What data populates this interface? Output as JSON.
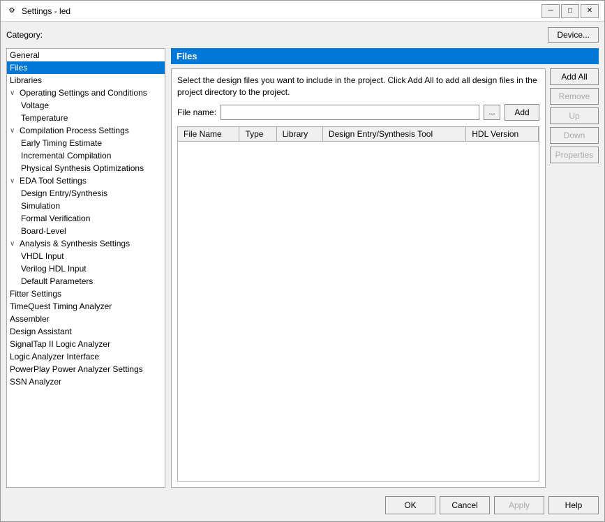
{
  "window": {
    "title": "Settings - led",
    "icon": "⚙"
  },
  "titlebar": {
    "minimize_label": "─",
    "maximize_label": "□",
    "close_label": "✕"
  },
  "header": {
    "category_label": "Category:",
    "device_button": "Device..."
  },
  "sidebar": {
    "items": [
      {
        "id": "general",
        "label": "General",
        "level": "level0",
        "selected": false,
        "toggle": ""
      },
      {
        "id": "files",
        "label": "Files",
        "level": "level0",
        "selected": true,
        "toggle": ""
      },
      {
        "id": "libraries",
        "label": "Libraries",
        "level": "level0",
        "selected": false,
        "toggle": ""
      },
      {
        "id": "operating-settings",
        "label": "Operating Settings and Conditions",
        "level": "level0",
        "selected": false,
        "toggle": "∨"
      },
      {
        "id": "voltage",
        "label": "Voltage",
        "level": "level1",
        "selected": false,
        "toggle": ""
      },
      {
        "id": "temperature",
        "label": "Temperature",
        "level": "level1",
        "selected": false,
        "toggle": ""
      },
      {
        "id": "compilation-process",
        "label": "Compilation Process Settings",
        "level": "level0",
        "selected": false,
        "toggle": "∨"
      },
      {
        "id": "early-timing",
        "label": "Early Timing Estimate",
        "level": "level1",
        "selected": false,
        "toggle": ""
      },
      {
        "id": "incremental",
        "label": "Incremental Compilation",
        "level": "level1",
        "selected": false,
        "toggle": ""
      },
      {
        "id": "physical-synthesis",
        "label": "Physical Synthesis Optimizations",
        "level": "level1",
        "selected": false,
        "toggle": ""
      },
      {
        "id": "eda-tool",
        "label": "EDA Tool Settings",
        "level": "level0",
        "selected": false,
        "toggle": "∨"
      },
      {
        "id": "design-entry",
        "label": "Design Entry/Synthesis",
        "level": "level1",
        "selected": false,
        "toggle": ""
      },
      {
        "id": "simulation",
        "label": "Simulation",
        "level": "level1",
        "selected": false,
        "toggle": ""
      },
      {
        "id": "formal-verification",
        "label": "Formal Verification",
        "level": "level1",
        "selected": false,
        "toggle": ""
      },
      {
        "id": "board-level",
        "label": "Board-Level",
        "level": "level1",
        "selected": false,
        "toggle": ""
      },
      {
        "id": "analysis-synthesis",
        "label": "Analysis & Synthesis Settings",
        "level": "level0",
        "selected": false,
        "toggle": "∨"
      },
      {
        "id": "vhdl-input",
        "label": "VHDL Input",
        "level": "level1",
        "selected": false,
        "toggle": ""
      },
      {
        "id": "verilog-hdl",
        "label": "Verilog HDL Input",
        "level": "level1",
        "selected": false,
        "toggle": ""
      },
      {
        "id": "default-params",
        "label": "Default Parameters",
        "level": "level1",
        "selected": false,
        "toggle": ""
      },
      {
        "id": "fitter",
        "label": "Fitter Settings",
        "level": "level0",
        "selected": false,
        "toggle": ""
      },
      {
        "id": "timequest",
        "label": "TimeQuest Timing Analyzer",
        "level": "level0",
        "selected": false,
        "toggle": ""
      },
      {
        "id": "assembler",
        "label": "Assembler",
        "level": "level0",
        "selected": false,
        "toggle": ""
      },
      {
        "id": "design-assistant",
        "label": "Design Assistant",
        "level": "level0",
        "selected": false,
        "toggle": ""
      },
      {
        "id": "signaltap",
        "label": "SignalTap II Logic Analyzer",
        "level": "level0",
        "selected": false,
        "toggle": ""
      },
      {
        "id": "logic-analyzer",
        "label": "Logic Analyzer Interface",
        "level": "level0",
        "selected": false,
        "toggle": ""
      },
      {
        "id": "powerplay",
        "label": "PowerPlay Power Analyzer Settings",
        "level": "level0",
        "selected": false,
        "toggle": ""
      },
      {
        "id": "ssn",
        "label": "SSN Analyzer",
        "level": "level0",
        "selected": false,
        "toggle": ""
      }
    ]
  },
  "panel": {
    "title": "Files",
    "description": "Select the design files you want to include in the project. Click Add All to add all design files in the project directory to the project.",
    "file_name_label": "File name:",
    "file_name_value": "",
    "file_name_placeholder": "",
    "browse_label": "...",
    "table": {
      "columns": [
        "File Name",
        "Type",
        "Library",
        "Design Entry/Synthesis Tool",
        "HDL Version"
      ],
      "rows": []
    },
    "buttons": {
      "add": "Add",
      "add_all": "Add All",
      "remove": "Remove",
      "up": "Up",
      "down": "Down",
      "properties": "Properties"
    }
  },
  "footer": {
    "ok_label": "OK",
    "cancel_label": "Cancel",
    "apply_label": "Apply",
    "help_label": "Help"
  }
}
